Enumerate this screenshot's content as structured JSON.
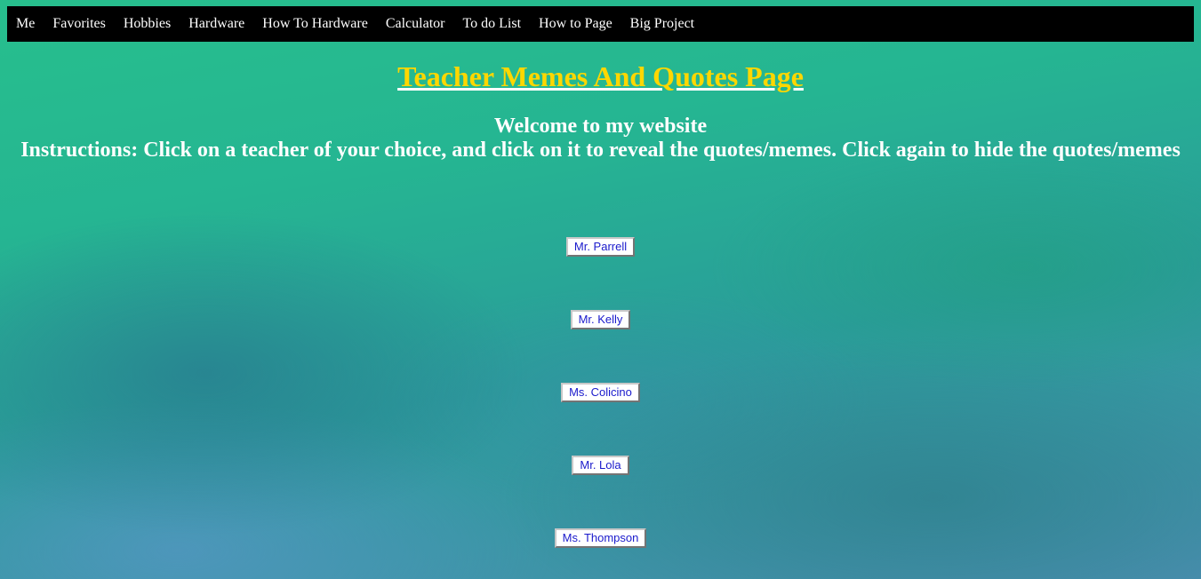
{
  "nav": {
    "items": [
      {
        "label": "Me"
      },
      {
        "label": "Favorites"
      },
      {
        "label": "Hobbies"
      },
      {
        "label": "Hardware"
      },
      {
        "label": "How To Hardware"
      },
      {
        "label": "Calculator"
      },
      {
        "label": "To do List"
      },
      {
        "label": "How to Page"
      },
      {
        "label": "Big Project"
      }
    ]
  },
  "header": {
    "title": "Teacher Memes And Quotes Page",
    "welcome": "Welcome to my website",
    "instructions": "Instructions: Click on a teacher of your choice, and click on it to reveal the quotes/memes. Click again to hide the quotes/memes"
  },
  "teachers": [
    {
      "label": "Mr. Parrell"
    },
    {
      "label": "Mr. Kelly"
    },
    {
      "label": "Ms. Colicino"
    },
    {
      "label": "Mr. Lola"
    },
    {
      "label": "Ms. Thompson"
    }
  ],
  "colors": {
    "title": "#ffd700",
    "navbar_bg": "#000000",
    "button_text": "#1a1acc"
  }
}
